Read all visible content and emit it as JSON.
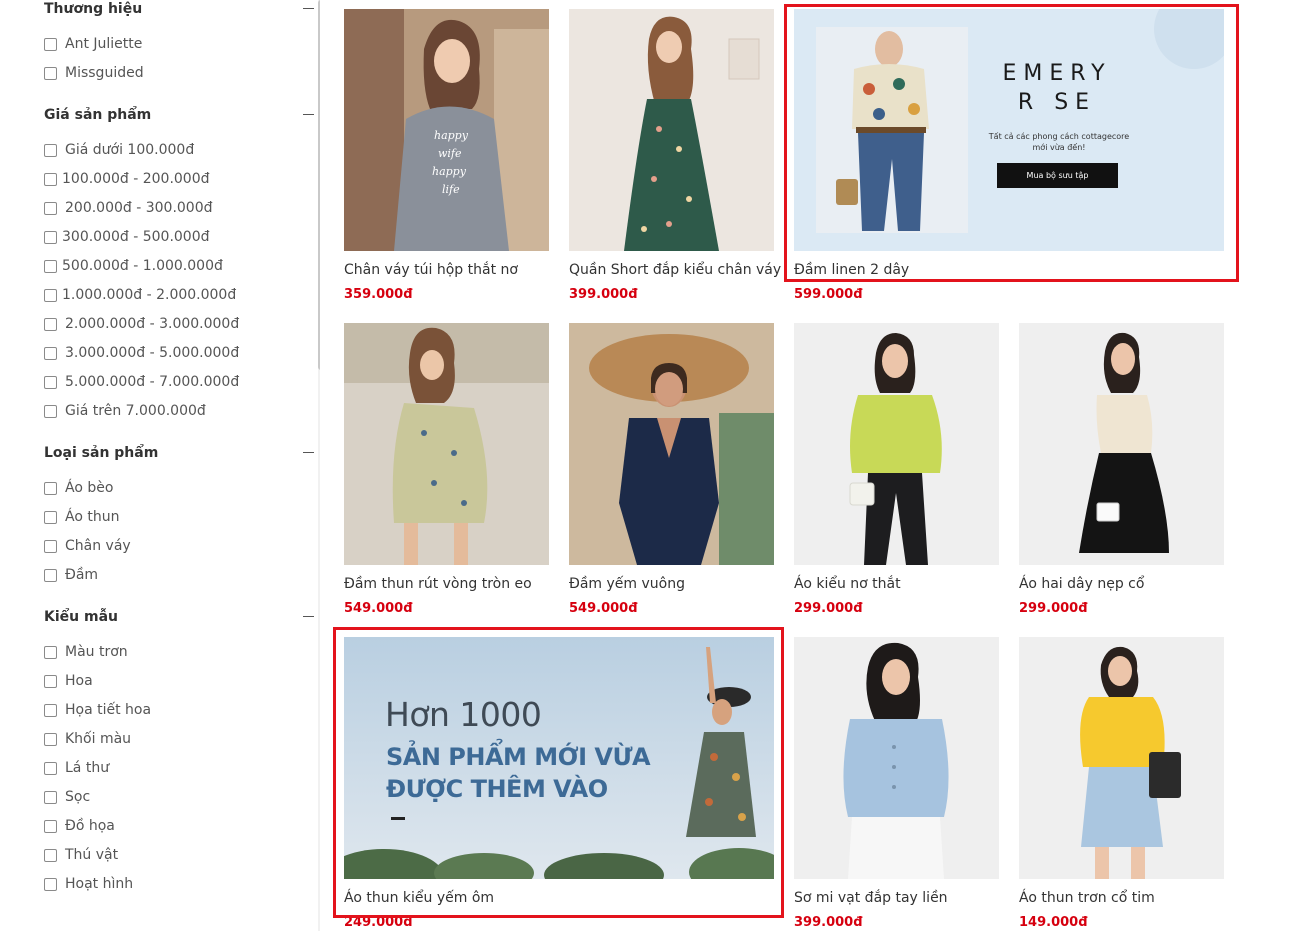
{
  "filters": [
    {
      "heading": "Thương hiệu",
      "options": [
        "Ant Juliette",
        "Missguided"
      ]
    },
    {
      "heading": "Giá sản phẩm",
      "options": [
        "Giá dưới 100.000đ",
        "100.000đ - 200.000đ",
        "200.000đ - 300.000đ",
        "300.000đ - 500.000đ",
        "500.000đ - 1.000.000đ",
        "1.000.000đ - 2.000.000đ",
        "2.000.000đ - 3.000.000đ",
        "3.000.000đ - 5.000.000đ",
        "5.000.000đ - 7.000.000đ",
        "Giá trên 7.000.000đ"
      ]
    },
    {
      "heading": "Loại sản phẩm",
      "options": [
        "Áo bèo",
        "Áo thun",
        "Chân váy",
        "Đầm"
      ]
    },
    {
      "heading": "Kiểu mẫu",
      "options": [
        "Màu trơn",
        "Hoa",
        "Họa tiết hoa",
        "Khối màu",
        "Lá thư",
        "Sọc",
        "Đồ họa",
        "Thú vật",
        "Hoạt hình"
      ]
    }
  ],
  "products": [
    {
      "name": "Chân váy túi hộp thắt nơ",
      "price": "359.000đ",
      "image": "woman-grey-shirt-dress"
    },
    {
      "name": "Quần Short đắp kiểu chân váy",
      "price": "399.000đ",
      "image": "woman-green-floral-slip-dress"
    },
    {
      "name": "Đầm linen 2 dây",
      "price": "599.000đ",
      "image": "emery-rose-banner"
    },
    {
      "name": "Đầm thun rút vòng tròn eo",
      "price": "549.000đ",
      "image": "woman-one-shoulder-floral-dress"
    },
    {
      "name": "Đầm yếm vuông",
      "price": "549.000đ",
      "image": "woman-sunhat-navy-romper"
    },
    {
      "name": "Áo kiểu nơ thắt",
      "price": "299.000đ",
      "image": "woman-lime-wrap-top"
    },
    {
      "name": "Áo hai dây nẹp cổ",
      "price": "299.000đ",
      "image": "woman-cream-cami-black-skirt"
    },
    {
      "name": "Áo thun kiểu yếm ôm",
      "price": "249.000đ",
      "image": "promo-banner"
    },
    {
      "name": "Sơ mi vạt đắp tay liền",
      "price": "399.000đ",
      "image": "woman-blue-shirt-white-skirt"
    },
    {
      "name": "Áo thun trơn cổ tim",
      "price": "149.000đ",
      "image": "woman-yellow-tee-denim-skirt"
    }
  ],
  "banner_emery": {
    "brand_line1": "EMERY",
    "brand_line2": "R SE",
    "tagline": "Tất cả các phong cách cottagecore mới vừa đến!",
    "cta": "Mua bộ sưu tập"
  },
  "banner_promo": {
    "line1": "Hơn 1000",
    "line2": "SẢN PHẨM MỚI VỪA",
    "line3": "ĐƯỢC THÊM VÀO"
  },
  "colors": {
    "price": "#d6000f",
    "highlight": "#e3131c",
    "text": "#333333"
  }
}
